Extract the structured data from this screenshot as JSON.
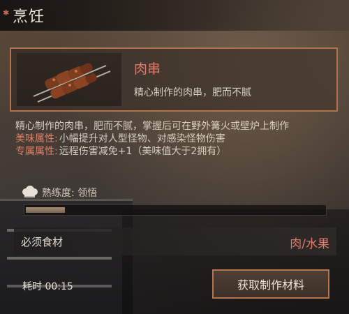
{
  "header": {
    "title": "烹饪"
  },
  "item": {
    "name": "肉串",
    "short_desc": "精心制作的肉串，肥而不腻",
    "icon": "meat-skewer-icon"
  },
  "details": {
    "description": "精心制作的肉串，肥而不腻，掌握后可在野外篝火或壁炉上制作",
    "attributes": [
      {
        "label": "美味属性:",
        "value": "小幅提升对人型怪物、对感染怪物伤害"
      },
      {
        "label": "专属属性:",
        "value": "远程伤害减免+1（美味值大于2拥有）"
      }
    ]
  },
  "proficiency": {
    "label": "熟练度: 领悟",
    "progress": 0.13
  },
  "requirement": {
    "label": "必须食材",
    "value": "肉/水果"
  },
  "footer": {
    "time": "耗时 00:15",
    "action_label": "获取制作材料"
  },
  "colors": {
    "accent_red": "#e07a6a",
    "border_orange": "#b4714b",
    "text_light": "#d7cdc0"
  }
}
